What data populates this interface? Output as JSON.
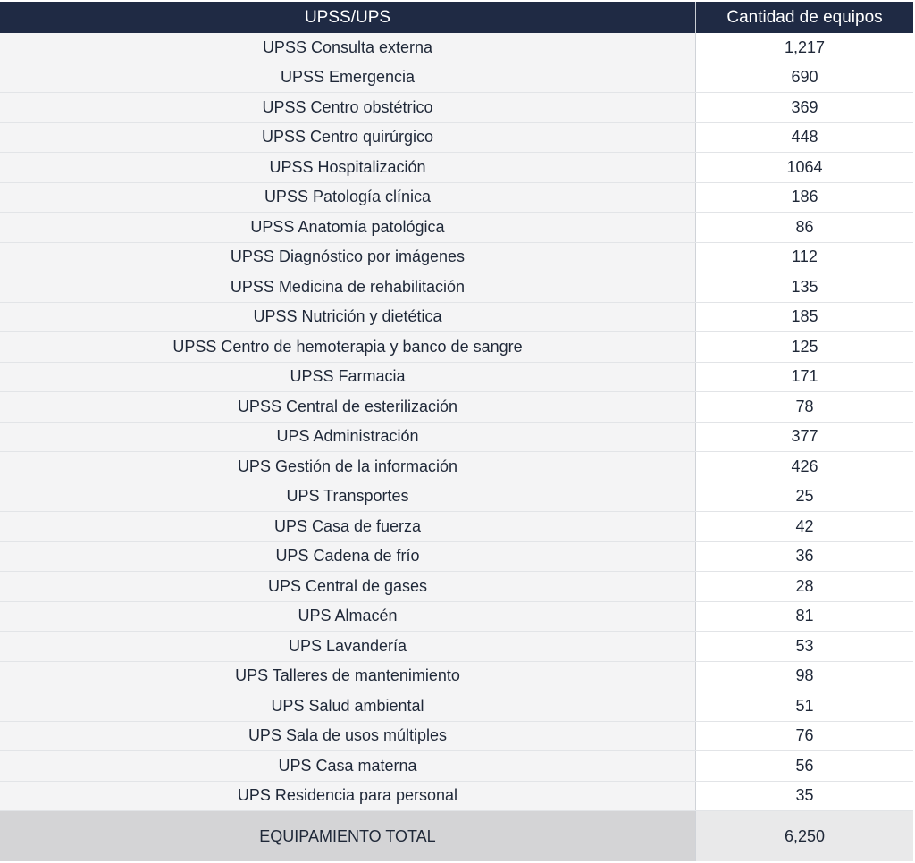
{
  "header": {
    "col1": "UPSS/UPS",
    "col2": "Cantidad de equipos"
  },
  "rows": [
    {
      "name": "UPSS Consulta externa",
      "value": "1,217"
    },
    {
      "name": "UPSS Emergencia",
      "value": "690"
    },
    {
      "name": "UPSS Centro obstétrico",
      "value": "369"
    },
    {
      "name": "UPSS Centro quirúrgico",
      "value": "448"
    },
    {
      "name": "UPSS Hospitalización",
      "value": "1064"
    },
    {
      "name": "UPSS Patología clínica",
      "value": "186"
    },
    {
      "name": "UPSS Anatomía patológica",
      "value": "86"
    },
    {
      "name": "UPSS Diagnóstico por imágenes",
      "value": "112"
    },
    {
      "name": "UPSS Medicina de rehabilitación",
      "value": "135"
    },
    {
      "name": "UPSS Nutrición y dietética",
      "value": "185"
    },
    {
      "name": "UPSS Centro de hemoterapia y banco de sangre",
      "value": "125"
    },
    {
      "name": "UPSS Farmacia",
      "value": "171"
    },
    {
      "name": "UPSS Central de esterilización",
      "value": "78"
    },
    {
      "name": "UPS Administración",
      "value": "377"
    },
    {
      "name": "UPS Gestión de la información",
      "value": "426"
    },
    {
      "name": "UPS Transportes",
      "value": "25"
    },
    {
      "name": "UPS Casa de fuerza",
      "value": "42"
    },
    {
      "name": "UPS Cadena de frío",
      "value": "36"
    },
    {
      "name": "UPS Central de gases",
      "value": "28"
    },
    {
      "name": "UPS Almacén",
      "value": "81"
    },
    {
      "name": "UPS Lavandería",
      "value": "53"
    },
    {
      "name": "UPS Talleres de mantenimiento",
      "value": "98"
    },
    {
      "name": "UPS Salud ambiental",
      "value": "51"
    },
    {
      "name": "UPS Sala de usos múltiples",
      "value": "76"
    },
    {
      "name": "UPS Casa materna",
      "value": "56"
    },
    {
      "name": "UPS Residencia para personal",
      "value": "35"
    }
  ],
  "total": {
    "label": "EQUIPAMIENTO TOTAL",
    "value": "6,250"
  }
}
